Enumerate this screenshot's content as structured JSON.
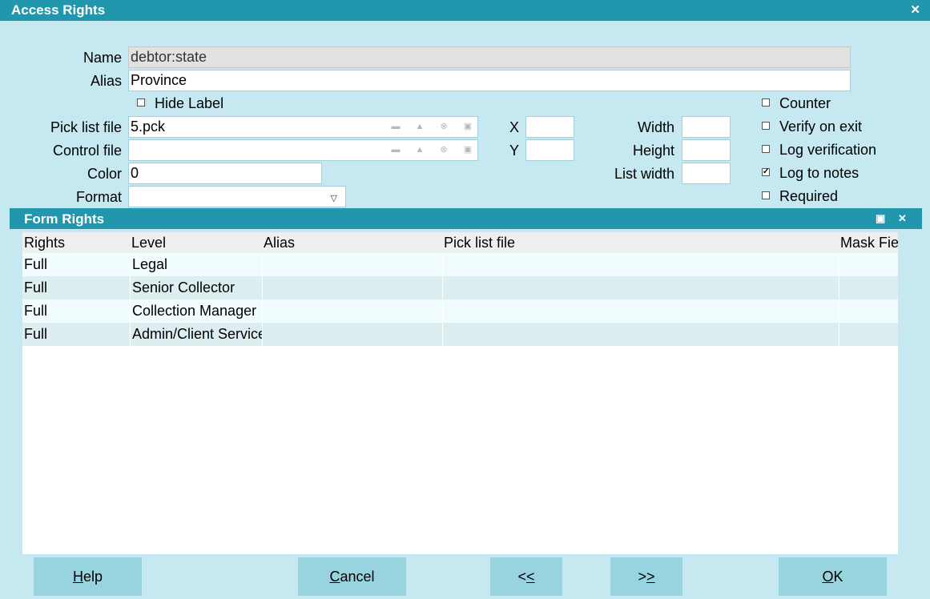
{
  "window": {
    "title": "Access Rights",
    "close_glyph": "✕"
  },
  "form": {
    "name_label": "Name",
    "name_value": "debtor:state",
    "alias_label": "Alias",
    "alias_value": "Province",
    "hide_label": {
      "label": "Hide Label",
      "checked": false
    },
    "pick_list_label": "Pick list file",
    "pick_list_value": "5.pck",
    "control_file_label": "Control file",
    "control_file_value": "",
    "color_label": "Color",
    "color_value": "0",
    "format_label": "Format",
    "format_value": "",
    "x_label": "X",
    "x_value": "",
    "y_label": "Y",
    "y_value": "",
    "width_label": "Width",
    "width_value": "",
    "height_label": "Height",
    "height_value": "",
    "list_width_label": "List width",
    "list_width_value": "",
    "file_field_icons": [
      "folder-open-icon",
      "print-icon",
      "clear-icon",
      "lock-icon"
    ]
  },
  "options": [
    {
      "label": "Counter",
      "checked": false
    },
    {
      "label": "Verify on exit",
      "checked": false
    },
    {
      "label": "Log verification",
      "checked": false
    },
    {
      "label": "Log to notes",
      "checked": true
    },
    {
      "label": "Required",
      "checked": false
    }
  ],
  "form_rights": {
    "title": "Form Rights",
    "columns": [
      "Rights",
      "Level",
      "Alias",
      "Pick list file",
      "Mask Fie"
    ],
    "rows": [
      {
        "rights": "Full",
        "level": "Legal",
        "alias": "",
        "pick": "",
        "mask": ""
      },
      {
        "rights": "Full",
        "level": "Senior Collector",
        "alias": "",
        "pick": "",
        "mask": ""
      },
      {
        "rights": "Full",
        "level": "Collection Manager",
        "alias": "",
        "pick": "",
        "mask": ""
      },
      {
        "rights": "Full",
        "level": "Admin/Client Service",
        "alias": "",
        "pick": "",
        "mask": ""
      }
    ]
  },
  "buttons": {
    "help": {
      "mnemonic": "H",
      "rest": "elp"
    },
    "cancel": {
      "mnemonic": "C",
      "rest": "ancel"
    },
    "prev": {
      "first": "<",
      "mnemonic": "<"
    },
    "next": {
      "first": ">",
      "mnemonic": ">"
    },
    "ok": {
      "mnemonic": "O",
      "rest": "K"
    }
  },
  "colors": {
    "titlebar": "#2196ad",
    "background": "#c6e9f1",
    "button": "#97d4e0"
  }
}
